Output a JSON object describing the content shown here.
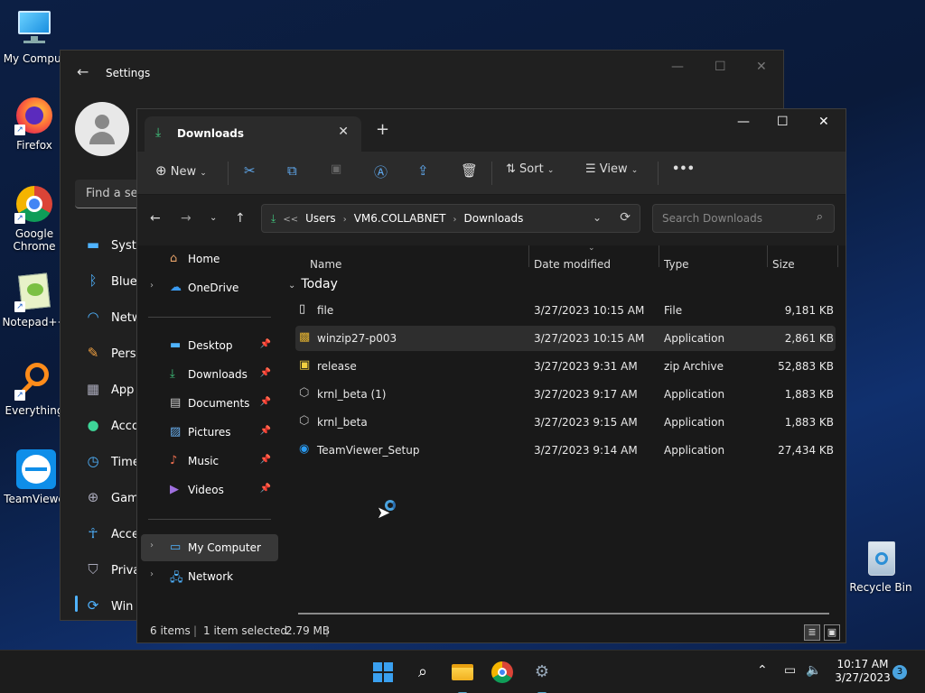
{
  "desktop": {
    "icons": [
      {
        "label": "My Comput",
        "icon": "monitor-icon"
      },
      {
        "label": "Firefox",
        "icon": "firefox-icon"
      },
      {
        "label": "Google Chrome",
        "icon": "chrome-icon"
      },
      {
        "label": "Notepad++",
        "icon": "notepadpp-icon"
      },
      {
        "label": "Everything",
        "icon": "everything-icon"
      },
      {
        "label": "TeamViewe",
        "icon": "teamviewer-icon"
      },
      {
        "label": "Recycle Bin",
        "icon": "recycle-bin-icon"
      }
    ]
  },
  "settings": {
    "title": "Settings",
    "search_placeholder": "Find a set",
    "nav": [
      {
        "label": "Syst",
        "icon": "display-icon"
      },
      {
        "label": "Blue",
        "icon": "bluetooth-icon"
      },
      {
        "label": "Netw",
        "icon": "wifi-icon"
      },
      {
        "label": "Pers",
        "icon": "brush-icon"
      },
      {
        "label": "App",
        "icon": "apps-icon"
      },
      {
        "label": "Acco",
        "icon": "person-icon"
      },
      {
        "label": "Time",
        "icon": "clock-icon"
      },
      {
        "label": "Gam",
        "icon": "gamepad-icon"
      },
      {
        "label": "Acce",
        "icon": "accessibility-icon"
      },
      {
        "label": "Priva",
        "icon": "shield-icon"
      },
      {
        "label": "Win",
        "icon": "update-icon"
      }
    ]
  },
  "explorer": {
    "tab_title": "Downloads",
    "toolbar": {
      "new_label": "New",
      "sort_label": "Sort",
      "view_label": "View",
      "more_label": "•••"
    },
    "address": {
      "crumbs": [
        "Users",
        "VM6.COLLABNET",
        "Downloads"
      ],
      "overflow": "<<"
    },
    "search_placeholder": "Search Downloads",
    "nav_pane": {
      "home": "Home",
      "onedrive": "OneDrive",
      "quick": [
        {
          "label": "Desktop",
          "icon": "desktop-folder-icon"
        },
        {
          "label": "Downloads",
          "icon": "download-icon"
        },
        {
          "label": "Documents",
          "icon": "documents-icon"
        },
        {
          "label": "Pictures",
          "icon": "pictures-icon"
        },
        {
          "label": "Music",
          "icon": "music-icon"
        },
        {
          "label": "Videos",
          "icon": "videos-icon"
        }
      ],
      "my_computer": "My Computer",
      "network": "Network"
    },
    "columns": {
      "name": "Name",
      "date": "Date modified",
      "type": "Type",
      "size": "Size"
    },
    "group_label": "Today",
    "files": [
      {
        "name": "file",
        "date": "3/27/2023 10:15 AM",
        "type": "File",
        "size": "9,181 KB",
        "icon": "file-icon",
        "selected": false
      },
      {
        "name": "winzip27-p003",
        "date": "3/27/2023 10:15 AM",
        "type": "Application",
        "size": "2,861 KB",
        "icon": "winzip-icon",
        "selected": true
      },
      {
        "name": "release",
        "date": "3/27/2023 9:31 AM",
        "type": "zip Archive",
        "size": "52,883 KB",
        "icon": "zip-icon",
        "selected": false
      },
      {
        "name": "krnl_beta (1)",
        "date": "3/27/2023 9:17 AM",
        "type": "Application",
        "size": "1,883 KB",
        "icon": "app-icon",
        "selected": false
      },
      {
        "name": "krnl_beta",
        "date": "3/27/2023 9:15 AM",
        "type": "Application",
        "size": "1,883 KB",
        "icon": "app-icon",
        "selected": false
      },
      {
        "name": "TeamViewer_Setup",
        "date": "3/27/2023 9:14 AM",
        "type": "Application",
        "size": "27,434 KB",
        "icon": "teamviewer-icon",
        "selected": false
      }
    ],
    "status": {
      "items": "6 items",
      "selected": "1 item selected",
      "size": "2.79 MB",
      "bar": "|"
    }
  },
  "taskbar": {
    "time": "10:17 AM",
    "date": "3/27/2023",
    "notifications": "3"
  }
}
